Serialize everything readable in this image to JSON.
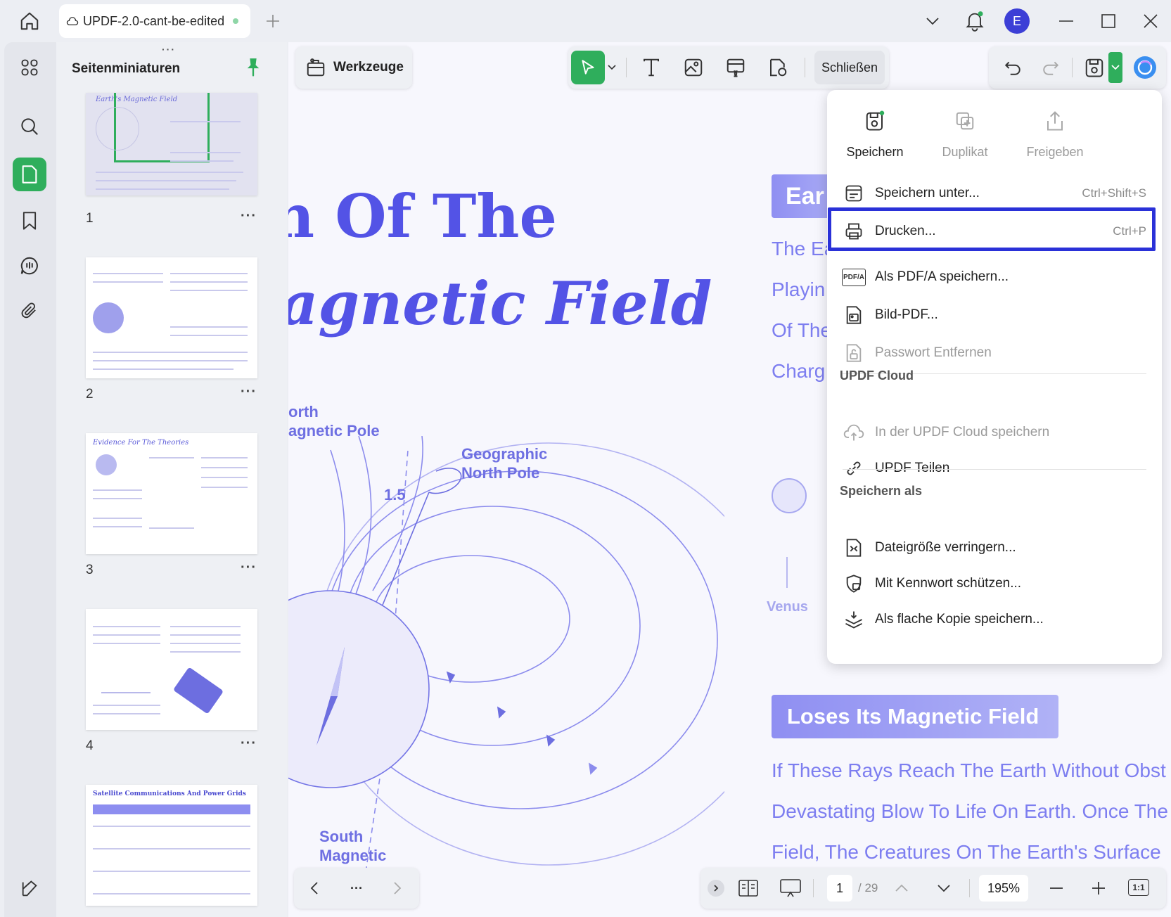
{
  "titlebar": {
    "tab_title": "UPDF-2.0-cant-be-edited",
    "avatar_letter": "E"
  },
  "sidebar": {
    "panel_title": "Seitenminiaturen",
    "thumbnails": [
      {
        "page": "1",
        "heading": "Earth's Magnetic Field"
      },
      {
        "page": "2",
        "heading": ""
      },
      {
        "page": "3",
        "heading": "Evidence For The Theories"
      },
      {
        "page": "4",
        "heading": ""
      },
      {
        "page": "",
        "heading": "Satellite Communications And Power Grids"
      }
    ],
    "more_label": "···"
  },
  "toolbar": {
    "tools_label": "Werkzeuge",
    "close_label": "Schließen"
  },
  "menu": {
    "top_actions": [
      {
        "label": "Speichern",
        "enabled": true
      },
      {
        "label": "Duplikat",
        "enabled": false
      },
      {
        "label": "Freigeben",
        "enabled": false
      }
    ],
    "save_as_label": "Speichern unter...",
    "save_as_shortcut": "Ctrl+Shift+S",
    "print_label": "Drucken...",
    "print_shortcut": "Ctrl+P",
    "pdfa_label": "Als PDF/A speichern...",
    "pdfa_icon_text": "PDF/A",
    "image_pdf_label": "Bild-PDF...",
    "remove_password_label": "Passwort Entfernen",
    "cloud_section": "UPDF Cloud",
    "cloud_save_label": "In der UPDF Cloud speichern",
    "share_label": "UPDF Teilen",
    "saveas_section": "Speichern als",
    "reduce_label": "Dateigröße verringern...",
    "protect_label": "Mit Kennwort schützen...",
    "flat_label": "Als flache Kopie speichern..."
  },
  "document": {
    "title_line1": "n Of The",
    "title_line2": "agnetic Field",
    "label_north_mag": "North\nMagnetic Pole",
    "label_north_mag_1": "orth",
    "label_north_mag_2": "agnetic Pole",
    "label_geo_1": "Geographic",
    "label_geo_2": "North Pole",
    "angle_label": "1.5",
    "label_south_1": "South",
    "label_south_2": "Magnetic",
    "pill_top": "Ear",
    "text_lines_right": [
      "The Ea",
      "Playin",
      "Of The",
      "Charg"
    ],
    "venus_label": "Venus",
    "pill_bottom": "Loses Its Magnetic Field",
    "bottom_lines": [
      "If These Rays Reach The Earth Without Obst",
      "Devastating Blow To Life On Earth. Once The",
      "Field, The Creatures On The Earth's Surface"
    ]
  },
  "pager": {
    "current_page": "1",
    "total_pages": "/ 29",
    "zoom": "195%",
    "fit_label": "1:1",
    "dots": "···"
  },
  "colors": {
    "accent_green": "#2fae5c",
    "doc_purple": "#5353e6",
    "highlight_blue": "#2a31d8"
  }
}
